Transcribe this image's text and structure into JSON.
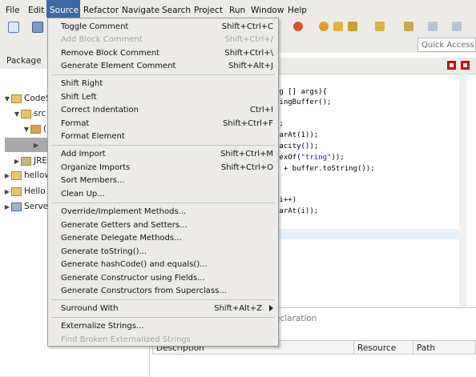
{
  "menubar": {
    "items": [
      {
        "label": "File"
      },
      {
        "label": "Edit"
      },
      {
        "label": "Source"
      },
      {
        "label": "Refactor"
      },
      {
        "label": "Navigate"
      },
      {
        "label": "Search"
      },
      {
        "label": "Project"
      },
      {
        "label": "Run"
      },
      {
        "label": "Window"
      },
      {
        "label": "Help"
      }
    ],
    "active_index": 2
  },
  "toolbar": {
    "quick_access": "Quick Access"
  },
  "left_pane": {
    "tab_label": "Package",
    "tree": [
      {
        "label": "CodeS",
        "twisty": "▼",
        "level": 0
      },
      {
        "label": "src",
        "twisty": "▼",
        "level": 1
      },
      {
        "label": "(",
        "twisty": "▼",
        "level": 2
      },
      {
        "label": "",
        "twisty": "▶",
        "level": 3
      },
      {
        "label": "JRE",
        "twisty": "▶",
        "level": 1
      },
      {
        "label": "hellow",
        "twisty": "▶",
        "level": 0
      },
      {
        "label": "Hello",
        "twisty": "▶",
        "level": 0
      },
      {
        "label": "Serve",
        "twisty": "▶",
        "level": 0
      }
    ]
  },
  "editor": {
    "lines": [
      {
        "pre": "ng [] args){",
        "str": "",
        "post": ""
      },
      {
        "pre": "ringBuffer();",
        "str": "",
        "post": ""
      },
      {
        "pre": "",
        "str": "",
        "post": ""
      },
      {
        "pre": ");",
        "str": "",
        "post": ""
      },
      {
        "pre": "harAt(1));",
        "str": "",
        "post": ""
      },
      {
        "pre": "pacity());",
        "str": "",
        "post": ""
      },
      {
        "pre": "dexOf(",
        "str": "\"tring\"",
        "post": "));"
      },
      {
        "pre": "\" + buffer.toString());",
        "str": "",
        "post": ""
      },
      {
        "pre": "",
        "str": "",
        "post": ""
      },
      {
        "pre": "",
        "str": "",
        "post": ""
      },
      {
        "pre": ";i++)",
        "str": "",
        "post": ""
      },
      {
        "pre": "harAt(i));",
        "str": "",
        "post": ""
      }
    ]
  },
  "bottom_pane": {
    "partial_label": "eclaration",
    "columns": [
      "Description",
      "Resource",
      "Path"
    ]
  },
  "source_menu": {
    "items": [
      {
        "label": "Toggle Comment",
        "shortcut": "Shift+Ctrl+C",
        "enabled": true
      },
      {
        "label": "Add Block Comment",
        "shortcut": "Shift+Ctrl+/",
        "enabled": false
      },
      {
        "label": "Remove Block Comment",
        "shortcut": "Shift+Ctrl+\\",
        "enabled": true
      },
      {
        "label": "Generate Element Comment",
        "shortcut": "Shift+Alt+J",
        "enabled": true
      },
      {
        "label": "Shift Right",
        "shortcut": "",
        "enabled": true
      },
      {
        "label": "Shift Left",
        "shortcut": "",
        "enabled": true
      },
      {
        "label": "Correct Indentation",
        "shortcut": "Ctrl+I",
        "enabled": true
      },
      {
        "label": "Format",
        "shortcut": "Shift+Ctrl+F",
        "enabled": true
      },
      {
        "label": "Format Element",
        "shortcut": "",
        "enabled": true
      },
      {
        "label": "Add Import",
        "shortcut": "Shift+Ctrl+M",
        "enabled": true
      },
      {
        "label": "Organize Imports",
        "shortcut": "Shift+Ctrl+O",
        "enabled": true
      },
      {
        "label": "Sort Members...",
        "shortcut": "",
        "enabled": true
      },
      {
        "label": "Clean Up...",
        "shortcut": "",
        "enabled": true
      },
      {
        "label": "Override/Implement Methods...",
        "shortcut": "",
        "enabled": true
      },
      {
        "label": "Generate Getters and Setters...",
        "shortcut": "",
        "enabled": true
      },
      {
        "label": "Generate Delegate Methods...",
        "shortcut": "",
        "enabled": true
      },
      {
        "label": "Generate toString()...",
        "shortcut": "",
        "enabled": true
      },
      {
        "label": "Generate hashCode() and equals()...",
        "shortcut": "",
        "enabled": true
      },
      {
        "label": "Generate Constructor using Fields...",
        "shortcut": "",
        "enabled": true
      },
      {
        "label": "Generate Constructors from Superclass...",
        "shortcut": "",
        "enabled": true
      },
      {
        "label": "Surround With",
        "shortcut": "Shift+Alt+Z",
        "enabled": true,
        "submenu": true
      },
      {
        "label": "Externalize Strings...",
        "shortcut": "",
        "enabled": true
      },
      {
        "label": "Find Broken Externalized Strings",
        "shortcut": "",
        "enabled": false
      }
    ]
  },
  "colors": {
    "menu_highlight": "#3c69a7",
    "string_literal": "#2a00ff",
    "view_button": "#d40000"
  }
}
